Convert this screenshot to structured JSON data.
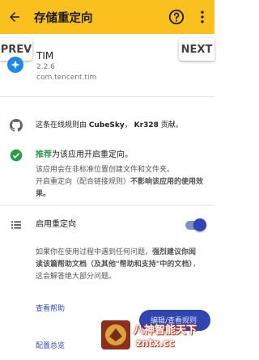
{
  "header": {
    "title": "存储重定向",
    "background": "#f9c01e"
  },
  "nav": {
    "prev": "PREV",
    "next": "NEXT"
  },
  "app": {
    "name": "TIM",
    "version": "2.2.6",
    "package": "com.tencent.tim"
  },
  "rule_source": {
    "prefix": "这条在线规则由 ",
    "author1": "CubeSky",
    "separator": "， ",
    "author2": "Kr328",
    "suffix": " 贡献。"
  },
  "recommendation": {
    "highlight": "推荐",
    "title_rest": "为该应用开启重定向。",
    "desc_line1": "该应用会在非标准位置创建文件和文件夹。",
    "desc_line2_a": "开启重定向（配合链接规则）",
    "desc_line2_b": "不影响该应用的使用效果。",
    "accent": "#2e9b47"
  },
  "toggle": {
    "label": "启用重定向",
    "enabled": true,
    "color": "#2f45b0"
  },
  "info": {
    "text_a": "如果你在使用过程中遇到任何问题，",
    "text_b": "强烈建议你阅读该篇帮助文档（及其他\"帮助和支持\"中的文档）",
    "text_c": "，这会解答绝大部分问题。"
  },
  "links": {
    "help": "查看帮助",
    "overview": "配置总览"
  },
  "fab": {
    "label": "编辑/查看规则"
  },
  "watermark": {
    "line1": "八神智能天下",
    "line2": "zntx.cc"
  },
  "icons": {
    "back": "arrow-back-icon",
    "help": "help-circle-icon",
    "more": "more-vert-icon",
    "app": "tim-app-icon",
    "github": "github-icon",
    "check": "check-circle-icon",
    "list": "list-icon"
  }
}
